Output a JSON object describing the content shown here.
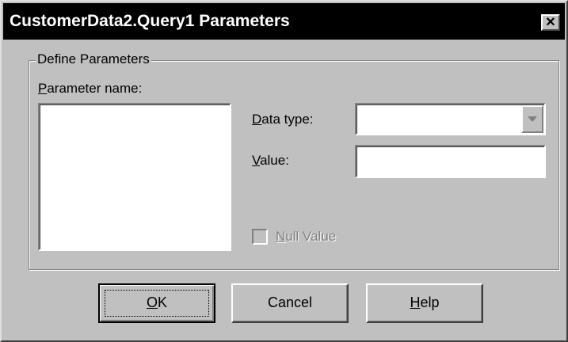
{
  "window": {
    "title": "CustomerData2.Query1 Parameters",
    "close_glyph": "✕"
  },
  "group": {
    "label": "Define Parameters"
  },
  "fields": {
    "parameter_name": {
      "accel": "P",
      "rest": "arameter name:",
      "items": []
    },
    "data_type": {
      "accel": "D",
      "rest": "ata type:",
      "value": ""
    },
    "value": {
      "accel": "V",
      "rest": "alue:",
      "value": ""
    },
    "null_value": {
      "accel": "N",
      "rest": "ull Value",
      "checked": false,
      "enabled": false
    }
  },
  "buttons": {
    "ok": {
      "accel": "O",
      "rest": "K"
    },
    "cancel": {
      "label": "Cancel"
    },
    "help": {
      "accel": "H",
      "rest": "elp"
    }
  },
  "colors": {
    "face": "#c0c0c0",
    "titlebar": "#000000",
    "disabled_text": "#808080"
  }
}
